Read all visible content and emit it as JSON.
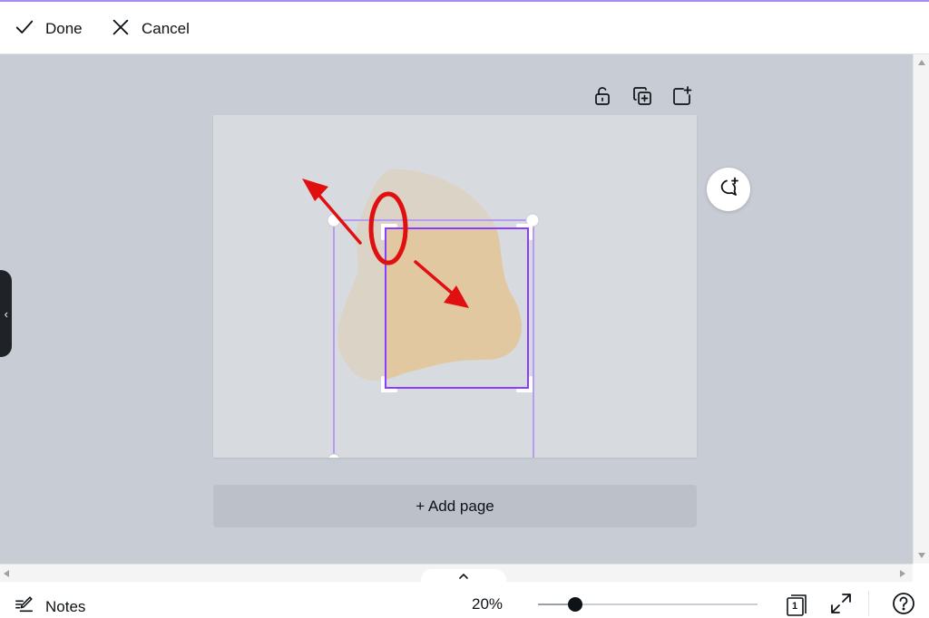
{
  "topbar": {
    "done_label": "Done",
    "cancel_label": "Cancel"
  },
  "canvas": {
    "page_background": "#d7dadf",
    "blob_color": "#e3c79f",
    "selection_color": "#8b3dff",
    "annotation_color": "#e01010"
  },
  "add_page": {
    "label": "+ Add page"
  },
  "bottom_bar": {
    "notes_label": "Notes",
    "zoom_label": "20%",
    "zoom_level": 0.17,
    "page_count": "1"
  },
  "icons": {
    "done": "check-icon",
    "cancel": "close-icon",
    "lock": "unlock-icon",
    "duplicate": "duplicate-page-icon",
    "add": "add-page-icon",
    "comment": "add-comment-icon",
    "notes": "notes-pencil-icon",
    "pages": "pages-icon",
    "fullscreen": "fullscreen-icon",
    "help": "help-icon"
  }
}
